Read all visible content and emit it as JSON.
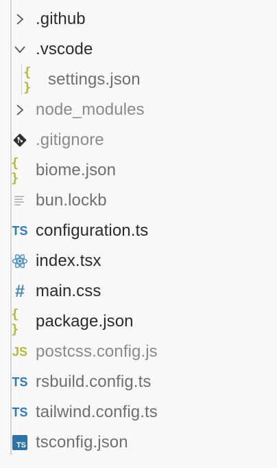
{
  "explorer": {
    "items": [
      {
        "label": ".github",
        "kind": "folder",
        "state": "collapsed",
        "icon": "chevron-right-icon",
        "tone": "normal"
      },
      {
        "label": ".vscode",
        "kind": "folder",
        "state": "expanded",
        "icon": "chevron-down-icon",
        "tone": "normal"
      },
      {
        "label": "settings.json",
        "kind": "file",
        "icon": "json-icon",
        "tone": "dim",
        "indent": 1
      },
      {
        "label": "node_modules",
        "kind": "folder",
        "state": "collapsed",
        "icon": "chevron-right-icon",
        "tone": "muted"
      },
      {
        "label": ".gitignore",
        "kind": "file",
        "icon": "git-icon",
        "tone": "muted"
      },
      {
        "label": "biome.json",
        "kind": "file",
        "icon": "json-icon",
        "tone": "dim"
      },
      {
        "label": "bun.lockb",
        "kind": "file",
        "icon": "text-file-icon",
        "tone": "dim"
      },
      {
        "label": "configuration.ts",
        "kind": "file",
        "icon": "typescript-icon",
        "tone": "normal"
      },
      {
        "label": "index.tsx",
        "kind": "file",
        "icon": "react-icon",
        "tone": "normal"
      },
      {
        "label": "main.css",
        "kind": "file",
        "icon": "css-icon",
        "tone": "normal"
      },
      {
        "label": "package.json",
        "kind": "file",
        "icon": "json-icon",
        "tone": "normal"
      },
      {
        "label": "postcss.config.js",
        "kind": "file",
        "icon": "javascript-icon",
        "tone": "muted"
      },
      {
        "label": "rsbuild.config.ts",
        "kind": "file",
        "icon": "typescript-icon",
        "tone": "dim"
      },
      {
        "label": "tailwind.config.ts",
        "kind": "file",
        "icon": "typescript-icon",
        "tone": "dim"
      },
      {
        "label": "tsconfig.json",
        "kind": "file",
        "icon": "tsconfig-icon",
        "tone": "dim"
      }
    ],
    "icon_glyphs": {
      "json": "{ }",
      "typescript": "TS",
      "javascript": "JS",
      "css": "#",
      "tsconfig": "TS"
    },
    "colors": {
      "json": "#b7b73f",
      "typescript": "#2f79b7",
      "react": "#4a8cc8",
      "git": "#2f2f2f",
      "tsconfig_bg": "#2f72a8"
    }
  }
}
